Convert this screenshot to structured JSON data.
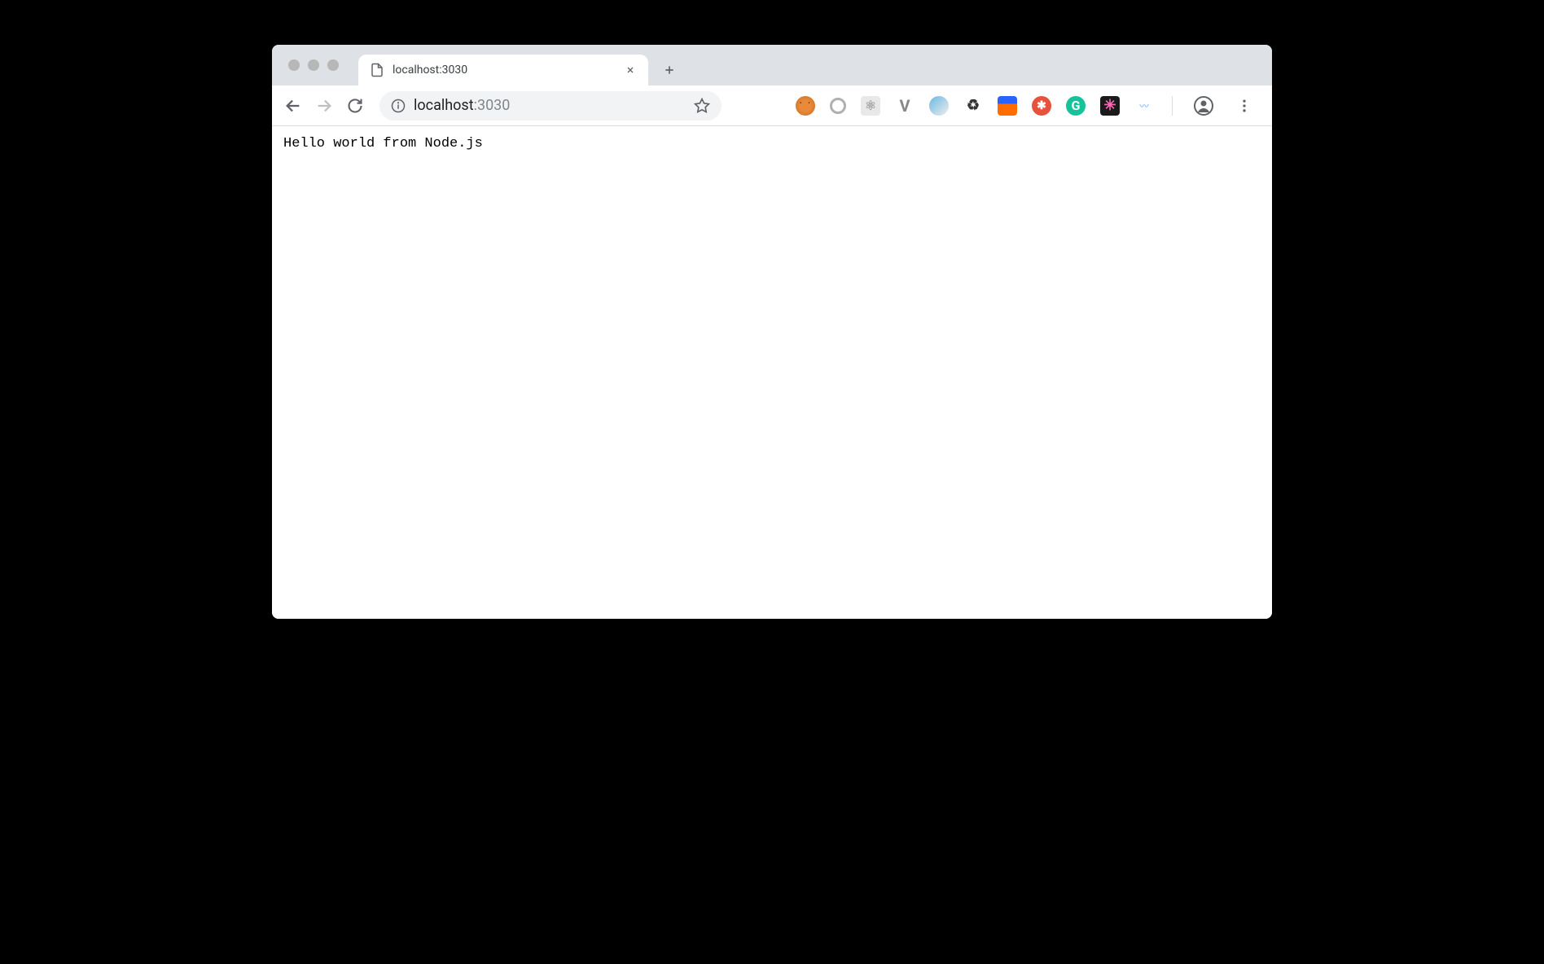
{
  "window": {
    "tab_title": "localhost:3030"
  },
  "address": {
    "host": "localhost",
    "port": ":3030"
  },
  "page": {
    "body_text": "Hello world from Node.js"
  },
  "icons": {
    "cookie": "cookie",
    "circle": "circle",
    "react": "⚛",
    "vue": "V",
    "swirl": "swirl",
    "recycle": "♻",
    "lighthouse": "▮",
    "target": "✱",
    "grammarly": "G",
    "dark": "✳",
    "wave": "〰"
  }
}
